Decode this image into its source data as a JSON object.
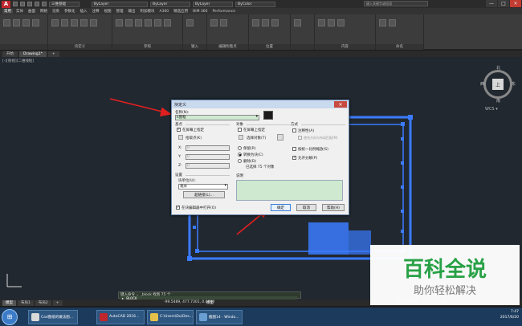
{
  "window": {
    "app_logo": "A",
    "menu_combo": "三维基础",
    "layer_combo": "ByLayer",
    "linetype_combo": "ByLayer",
    "lineweight_combo": "ByLayer",
    "color_combo": "ByColor",
    "search_placeholder": "键入关键字或短语",
    "min": "—",
    "max": "□",
    "close": "✕"
  },
  "ribbon": {
    "tabs": [
      "常用",
      "实体",
      "曲面",
      "网格",
      "渲染",
      "参数化",
      "插入",
      "注释",
      "视图",
      "管理",
      "输出",
      "附加模块",
      "A360",
      "精选应用",
      "BIM 360",
      "Performance"
    ],
    "active_tab": 0,
    "panels": [
      "",
      "块定义",
      "参照",
      "输入",
      "编辑附着点",
      "位置",
      "",
      "内容",
      "命名"
    ]
  },
  "doc_tabs": [
    "开始",
    "Drawing1*",
    "+"
  ],
  "viewport_label": "[-][俯视][二维线框]",
  "viewcube": {
    "north": "北",
    "south": "南",
    "west": "西",
    "east": "东",
    "face": "上",
    "wcs": "WCS ▾"
  },
  "dialog": {
    "title": "块定义",
    "close": "✕",
    "name_label": "名称(N):",
    "name_value": "k图框",
    "base_point": {
      "title": "基点",
      "specify_on_screen": "在屏幕上指定",
      "pick_point": "拾取点(K)",
      "x_label": "X:",
      "x_value": "0",
      "y_label": "Y:",
      "y_value": "0",
      "z_label": "Z:",
      "z_value": "0"
    },
    "objects": {
      "title": "对象",
      "specify_on_screen": "在屏幕上指定",
      "select_objects": "选择对象(T)",
      "retain": "保留(R)",
      "convert_to_block": "转换为块(C)",
      "delete": "删除(D)",
      "selected_count": "已选择 75 个对象"
    },
    "behavior": {
      "title": "方式",
      "annotative": "注释性(A)",
      "match_orientation": "使块方向与布局匹配(M)",
      "scale_uniformly": "按统一比例缩放(S)",
      "allow_exploding": "允许分解(P)"
    },
    "settings": {
      "title": "设置",
      "block_unit_label": "块单位(U):",
      "block_unit_value": "毫米",
      "hyperlink": "超链接(L)..."
    },
    "description_label": "说明",
    "open_in_editor": "在块编辑器中打开(O)",
    "ok": "确定",
    "cancel": "取消",
    "help": "帮助(H)"
  },
  "command_line": "键入命令 ⌄ _block 找到 75 个",
  "command_prompt": "▸_ BLOCK",
  "layout_tabs": [
    "模型",
    "布局1",
    "布局2",
    "+"
  ],
  "status": {
    "coords": "-99.5489, 477.7301, 0.0000",
    "model": "模型",
    "scale": "1:1 / 100% ▾",
    "unit": "小数"
  },
  "taskbar": {
    "start": "⊞",
    "items": [
      "Cad图纸的做法图...",
      "AutoCAD 2016...",
      "C:\\Users\\Du\\Des...",
      "截图14 - Windo..."
    ],
    "clock_time": "7:47",
    "clock_date": "2017/6/20"
  },
  "watermark": {
    "title": "百科全说",
    "subtitle": "助你轻松解决"
  }
}
